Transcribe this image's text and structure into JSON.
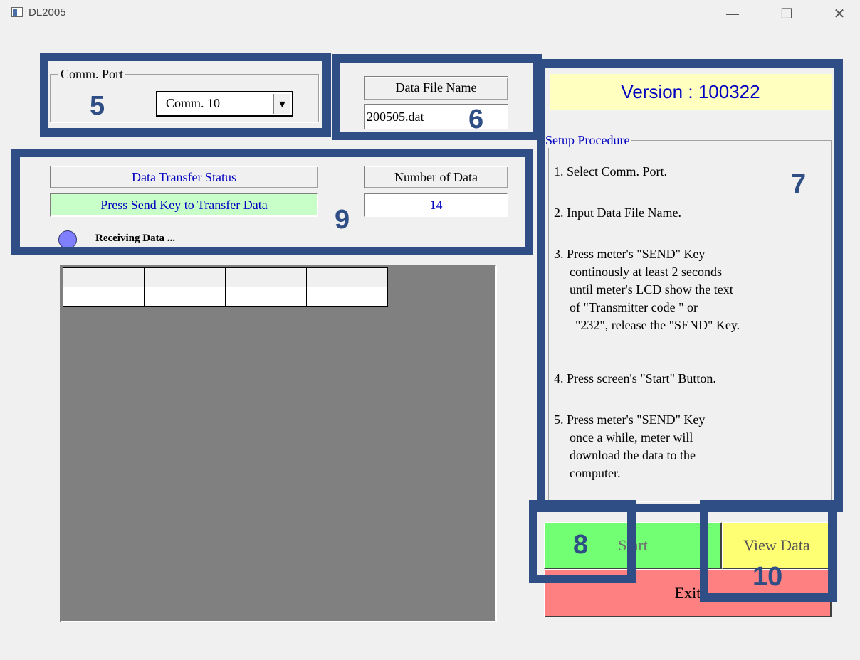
{
  "window": {
    "title": "DL2005"
  },
  "comm_port": {
    "label": "Comm. Port",
    "selected": "Comm. 10"
  },
  "data_file": {
    "label": "Data File Name",
    "value": "200505.dat"
  },
  "transfer": {
    "status_label": "Data Transfer Status",
    "status_text": "Press Send Key to Transfer Data",
    "count_label": "Number of Data",
    "count_value": "14",
    "receiving_text": "Receiving Data ..."
  },
  "version": {
    "text": "Version : 100322"
  },
  "setup": {
    "label": "Setup Procedure",
    "steps": [
      "1. Select Comm. Port.",
      "2. Input Data File Name.",
      "3. Press meter's \"SEND\" Key",
      "continously at least 2 seconds",
      "until meter's LCD show the text",
      "of  \"Transmitter code \" or",
      "\"232\", release the \"SEND\" Key.",
      "4. Press screen's \"Start\" Button.",
      "5. Press meter's \"SEND\" Key",
      "once a while, meter will",
      "download the data to the",
      "computer."
    ]
  },
  "buttons": {
    "start": "Start",
    "view": "View Data",
    "exit": "Exit"
  },
  "annotations": {
    "n5": "5",
    "n6": "6",
    "n7": "7",
    "n8": "8",
    "n9": "9",
    "n10": "10"
  },
  "colors": {
    "accent": "#2f4e86",
    "status_bg": "#c8ffc8",
    "version_bg": "#ffffc0",
    "start_bg": "#73ff73",
    "view_bg": "#ffff73",
    "exit_bg": "#ff8080",
    "indicator": "#8080ff"
  }
}
